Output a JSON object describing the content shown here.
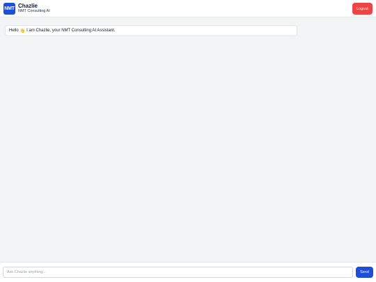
{
  "header": {
    "logo_text": "NMT",
    "app_name": "Chazlie",
    "subtitle": "NMT Consulting AI",
    "logout_label": "Logout"
  },
  "messages": [
    {
      "role": "assistant",
      "before": "Hello",
      "emoji": "👋",
      "after": "I am Chazlie, your NMT Consulting AI Assistant."
    }
  ],
  "composer": {
    "placeholder": "Ask Chazlie anything...",
    "value": "",
    "send_label": "Send"
  },
  "colors": {
    "brand": "#1d4ed8",
    "logout": "#ef4444",
    "background": "#f3f4f6"
  }
}
